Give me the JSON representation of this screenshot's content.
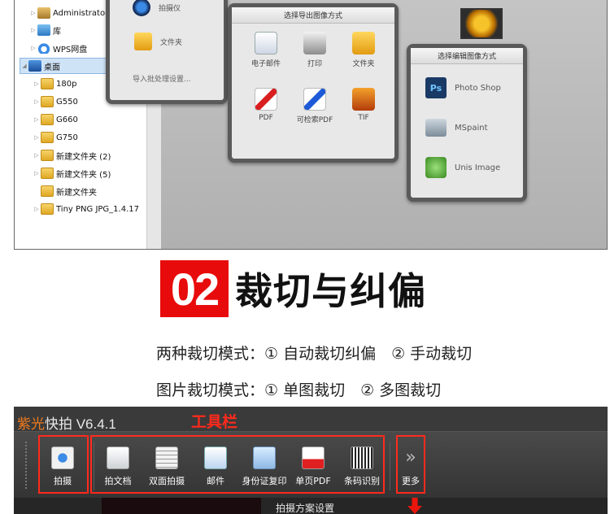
{
  "tree": {
    "items": [
      "Administrator",
      "库",
      "WPS网盘",
      "桌面",
      "180p",
      "G550",
      "G660",
      "G750",
      "新建文件夹 (2)",
      "新建文件夹 (5)",
      "新建文件夹",
      "Tiny PNG JPG_1.4.17"
    ]
  },
  "import_panel": {
    "camera_label": "拍摄仪",
    "folder_label": "文件夹",
    "settings_label": "导入批处理设置..."
  },
  "export_panel": {
    "title": "选择导出图像方式",
    "tiles": [
      "电子邮件",
      "打印",
      "文件夹",
      "PDF",
      "可检索PDF",
      "TIF"
    ]
  },
  "edit_panel": {
    "title": "选择编辑图像方式",
    "options": [
      "Photo Shop",
      "MSpaint",
      "Unis Image"
    ],
    "ps_glyph": "Ps"
  },
  "heading": {
    "number": "02",
    "title": "裁切与纠偏"
  },
  "descriptions": {
    "line1": "两种裁切模式：① 自动裁切纠偏　② 手动裁切",
    "line2": "图片裁切模式：① 单图裁切　② 多图裁切"
  },
  "app": {
    "brand": "紫光",
    "name": "快拍 V6.4.1",
    "toolbar_tag": "工具栏",
    "buttons": [
      "拍摄",
      "拍文档",
      "双面拍摄",
      "邮件",
      "身份证复印",
      "单页PDF",
      "条码识别",
      "更多"
    ],
    "status_setting": "拍摄方案设置",
    "more_glyph": "»"
  },
  "colors": {
    "accent_red": "#e80b0b",
    "brand_orange": "#f07b1d",
    "toolbar_dark": "#3a3a3a"
  }
}
